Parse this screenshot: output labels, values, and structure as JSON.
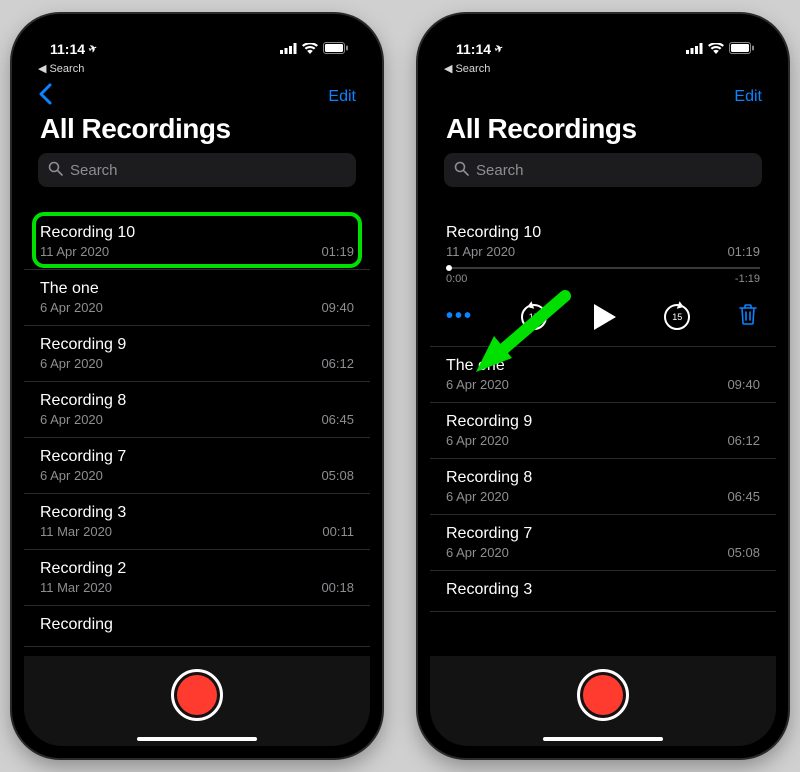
{
  "status": {
    "time": "11:14",
    "location_arrow": "➤",
    "back_app": "Search"
  },
  "nav": {
    "edit_label": "Edit"
  },
  "page_title": "All Recordings",
  "search_placeholder": "Search",
  "left": {
    "items": [
      {
        "name": "Recording 10",
        "date": "11 Apr 2020",
        "duration": "01:19"
      },
      {
        "name": "The one",
        "date": "6 Apr 2020",
        "duration": "09:40"
      },
      {
        "name": "Recording 9",
        "date": "6 Apr 2020",
        "duration": "06:12"
      },
      {
        "name": "Recording 8",
        "date": "6 Apr 2020",
        "duration": "06:45"
      },
      {
        "name": "Recording 7",
        "date": "6 Apr 2020",
        "duration": "05:08"
      },
      {
        "name": "Recording 3",
        "date": "11 Mar 2020",
        "duration": "00:11"
      },
      {
        "name": "Recording 2",
        "date": "11 Mar 2020",
        "duration": "00:18"
      },
      {
        "name": "Recording",
        "date": "",
        "duration": ""
      }
    ]
  },
  "right": {
    "expanded": {
      "name": "Recording 10",
      "date": "11 Apr 2020",
      "duration": "01:19",
      "elapsed": "0:00",
      "remaining": "-1:19",
      "skip_seconds": "15"
    },
    "items": [
      {
        "name": "The one",
        "date": "6 Apr 2020",
        "duration": "09:40"
      },
      {
        "name": "Recording 9",
        "date": "6 Apr 2020",
        "duration": "06:12"
      },
      {
        "name": "Recording 8",
        "date": "6 Apr 2020",
        "duration": "06:45"
      },
      {
        "name": "Recording 7",
        "date": "6 Apr 2020",
        "duration": "05:08"
      },
      {
        "name": "Recording 3",
        "date": "",
        "duration": ""
      }
    ]
  },
  "colors": {
    "accent": "#0a84ff",
    "highlight": "#00e000",
    "record": "#ff3b30"
  }
}
